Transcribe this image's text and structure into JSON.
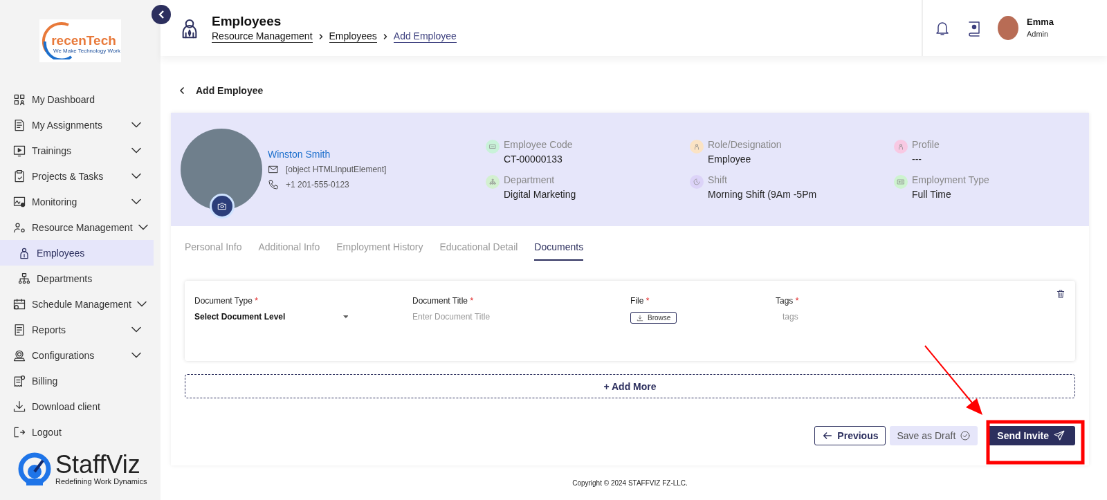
{
  "sidebar": {
    "logo": {
      "name": "recenTech",
      "tagline": "We Make Technology Work"
    },
    "items": [
      {
        "label": "My Dashboard",
        "kind": "link",
        "selected": false
      },
      {
        "label": "My Assignments",
        "kind": "group",
        "selected": false
      },
      {
        "label": "Trainings",
        "kind": "group",
        "selected": false
      },
      {
        "label": "Projects & Tasks",
        "kind": "group",
        "selected": false
      },
      {
        "label": "Monitoring",
        "kind": "group",
        "selected": false
      },
      {
        "label": "Resource Management",
        "kind": "group",
        "selected": false,
        "children": [
          {
            "label": "Employees",
            "selected": true
          },
          {
            "label": "Departments",
            "selected": false
          }
        ]
      },
      {
        "label": "Schedule Management",
        "kind": "group",
        "selected": false
      },
      {
        "label": "Reports",
        "kind": "group",
        "selected": false
      },
      {
        "label": "Configurations",
        "kind": "group",
        "selected": false
      },
      {
        "label": "Billing",
        "kind": "link",
        "selected": false
      },
      {
        "label": "Download client",
        "kind": "link",
        "selected": false
      },
      {
        "label": "Logout",
        "kind": "link",
        "selected": false
      }
    ],
    "brand": {
      "name": "StaffViz",
      "tagline": "Redefining Work Dynamics"
    }
  },
  "header": {
    "title": "Employees",
    "breadcrumbs": [
      {
        "label": "Resource Management",
        "current": false
      },
      {
        "label": "Employees",
        "current": false
      },
      {
        "label": "Add Employee",
        "current": true
      }
    ],
    "user": {
      "name": "Emma",
      "role": "Admin"
    }
  },
  "page_title": "Add Employee",
  "profile": {
    "name": "Winston Smith",
    "email": "[object HTMLInputElement]",
    "phone": "+1 201-555-0123",
    "fields": [
      {
        "label": "Employee Code",
        "value": "CT-00000133",
        "color": "#c9f2d9"
      },
      {
        "label": "Role/Designation",
        "value": "Employee",
        "color": "#fbe3c4"
      },
      {
        "label": "Profile",
        "value": "---",
        "color": "#f8c9e3"
      },
      {
        "label": "Department",
        "value": "Digital Marketing",
        "color": "#d3f0d0"
      },
      {
        "label": "Shift",
        "value": "Morning Shift (9Am -5Pm",
        "color": "#dcd3f8"
      },
      {
        "label": "Employment Type",
        "value": "Full Time",
        "color": "#cdf3cf"
      }
    ]
  },
  "tabs": [
    {
      "label": "Personal Info",
      "selected": false
    },
    {
      "label": "Additional Info",
      "selected": false
    },
    {
      "label": "Employment History",
      "selected": false
    },
    {
      "label": "Educational Detail",
      "selected": false
    },
    {
      "label": "Documents",
      "selected": true
    }
  ],
  "document_fields": [
    {
      "label": "Document Type",
      "required_mark": "*",
      "kind": "select",
      "value": "Select Document Level"
    },
    {
      "label": "Document Title",
      "required_mark": "*",
      "kind": "input",
      "placeholder": "Enter Document Title"
    },
    {
      "label": "File",
      "required_mark": "*",
      "kind": "file",
      "button": "Browse"
    },
    {
      "label": "Tags",
      "required_mark": "*",
      "kind": "input",
      "placeholder": "tags"
    }
  ],
  "add_more": "+ Add More",
  "buttons": [
    {
      "label": "Previous",
      "kind": "back"
    },
    {
      "label": "Save as Draft",
      "kind": "draft"
    },
    {
      "label": "Send Invite",
      "kind": "primary"
    }
  ],
  "copyright": "Copyright © 2024 STAFFVIZ FZ-LLC."
}
